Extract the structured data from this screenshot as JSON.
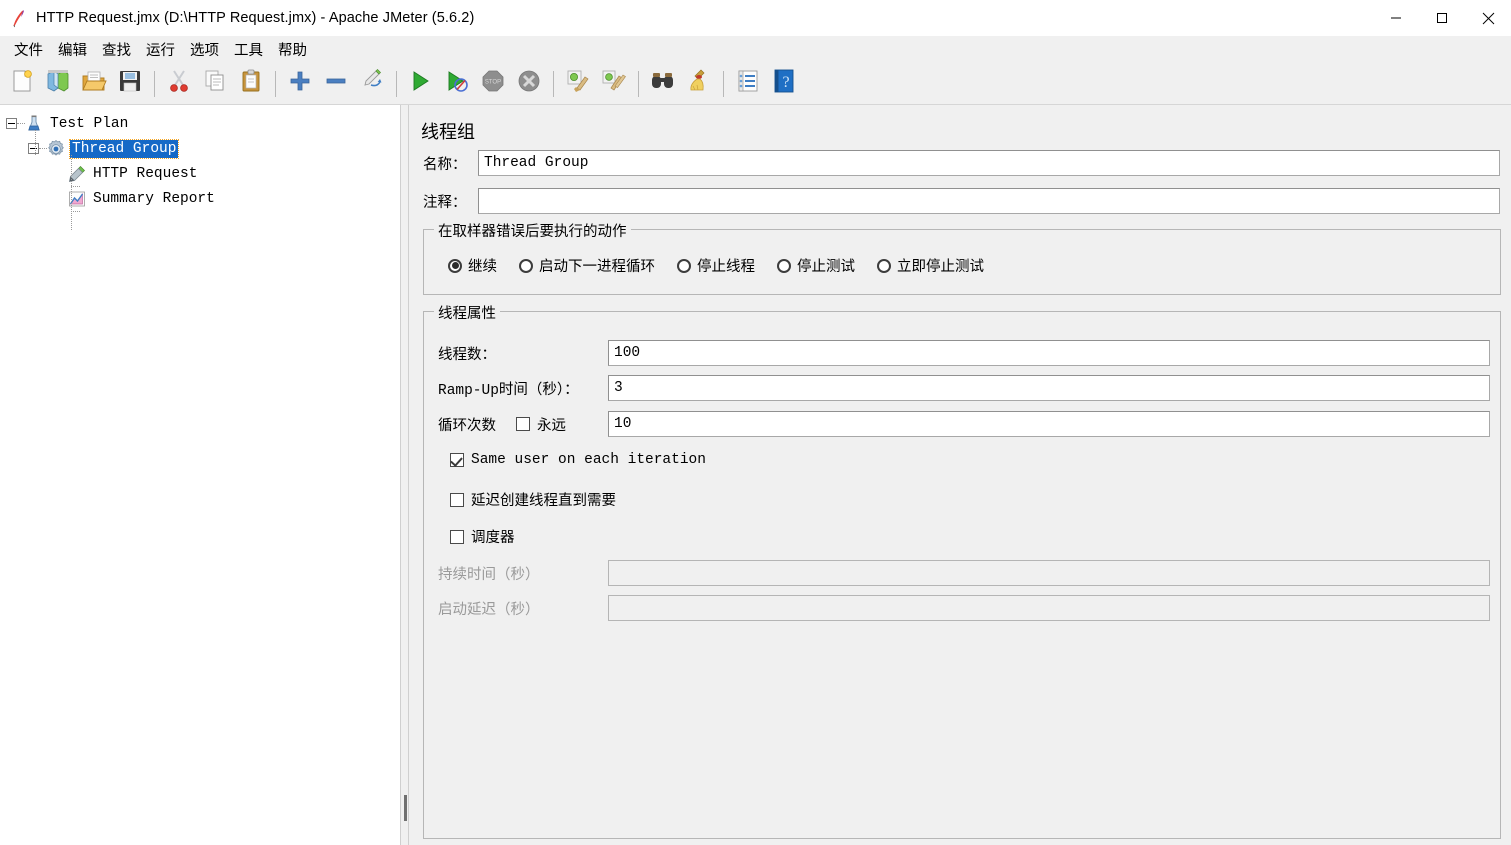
{
  "window": {
    "title": "HTTP Request.jmx (D:\\HTTP Request.jmx) - Apache JMeter (5.6.2)",
    "app_icon": "jmeter-feather-icon",
    "controls": {
      "minimize": "—",
      "maximize": "□",
      "close": "✕"
    }
  },
  "menubar": {
    "items": [
      {
        "label": "文件"
      },
      {
        "label": "编辑"
      },
      {
        "label": "查找"
      },
      {
        "label": "运行"
      },
      {
        "label": "选项"
      },
      {
        "label": "工具"
      },
      {
        "label": "帮助"
      }
    ]
  },
  "toolbar": {
    "buttons": [
      {
        "name": "new-icon",
        "type": "icon"
      },
      {
        "name": "templates-icon",
        "type": "icon"
      },
      {
        "name": "open-icon",
        "type": "icon"
      },
      {
        "name": "save-icon",
        "type": "icon"
      },
      {
        "name": "separator",
        "type": "sep"
      },
      {
        "name": "cut-icon",
        "type": "icon"
      },
      {
        "name": "copy-icon",
        "type": "icon"
      },
      {
        "name": "paste-icon",
        "type": "icon"
      },
      {
        "name": "separator",
        "type": "sep"
      },
      {
        "name": "expand-all-icon",
        "type": "icon"
      },
      {
        "name": "collapse-all-icon",
        "type": "icon"
      },
      {
        "name": "toggle-icon",
        "type": "icon"
      },
      {
        "name": "separator",
        "type": "sep"
      },
      {
        "name": "start-icon",
        "type": "icon"
      },
      {
        "name": "start-no-pauses-icon",
        "type": "icon"
      },
      {
        "name": "stop-icon",
        "type": "icon",
        "disabled": true
      },
      {
        "name": "shutdown-icon",
        "type": "icon",
        "disabled": true
      },
      {
        "name": "separator",
        "type": "sep"
      },
      {
        "name": "clear-icon",
        "type": "icon"
      },
      {
        "name": "clear-all-icon",
        "type": "icon"
      },
      {
        "name": "separator",
        "type": "sep"
      },
      {
        "name": "search-icon",
        "type": "icon"
      },
      {
        "name": "reset-search-icon",
        "type": "icon"
      },
      {
        "name": "separator",
        "type": "sep"
      },
      {
        "name": "function-helper-icon",
        "type": "icon"
      },
      {
        "name": "help-icon",
        "type": "icon"
      }
    ]
  },
  "tree": {
    "nodes": [
      {
        "label": "Test Plan",
        "icon": "test-plan-icon",
        "depth": 0,
        "expanded": true,
        "selected": false
      },
      {
        "label": "Thread Group",
        "icon": "thread-group-icon",
        "depth": 1,
        "expanded": true,
        "selected": true
      },
      {
        "label": "HTTP Request",
        "icon": "http-request-icon",
        "depth": 2,
        "expanded": false,
        "selected": false
      },
      {
        "label": "Summary Report",
        "icon": "summary-report-icon",
        "depth": 2,
        "expanded": false,
        "selected": false
      }
    ]
  },
  "editor": {
    "title": "线程组",
    "name_label": "名称：",
    "name_value": "Thread Group",
    "comment_label": "注释：",
    "comment_value": "",
    "error_action": {
      "legend": "在取样器错误后要执行的动作",
      "options": [
        {
          "label": "继续",
          "selected": true
        },
        {
          "label": "启动下一进程循环",
          "selected": false
        },
        {
          "label": "停止线程",
          "selected": false
        },
        {
          "label": "停止测试",
          "selected": false
        },
        {
          "label": "立即停止测试",
          "selected": false
        }
      ]
    },
    "thread_props": {
      "legend": "线程属性",
      "threads_label": "线程数：",
      "threads_value": "100",
      "rampup_label": "Ramp-Up时间（秒）：",
      "rampup_value": "3",
      "loops_label": "循环次数",
      "forever_label": "永远",
      "forever_checked": false,
      "loops_value": "10",
      "same_user_label": "Same user on each iteration",
      "same_user_checked": true,
      "delay_create_label": "延迟创建线程直到需要",
      "delay_create_checked": false,
      "scheduler_label": "调度器",
      "scheduler_checked": false,
      "duration_label": "持续时间（秒）",
      "duration_value": "",
      "duration_disabled": true,
      "startup_delay_label": "启动延迟（秒）",
      "startup_delay_value": "",
      "startup_delay_disabled": true
    }
  },
  "colors": {
    "selection_blue": "#1569c7",
    "focus_outline": "#f5a623",
    "panel_bg": "#f0f0f0",
    "field_bg": "#ffffff",
    "disabled_text": "#9a9a9a"
  }
}
